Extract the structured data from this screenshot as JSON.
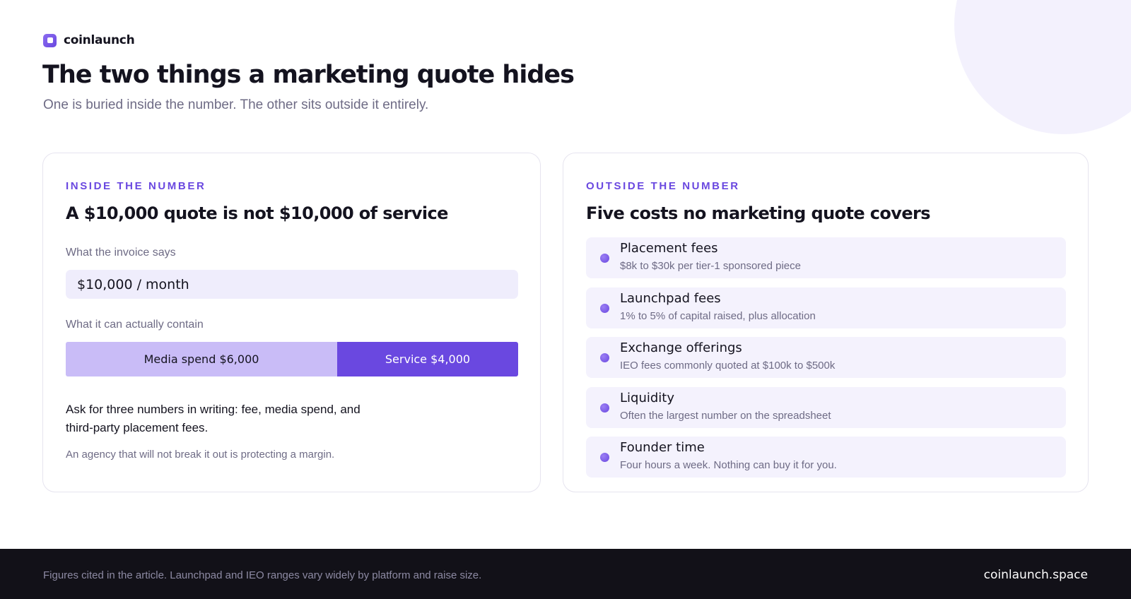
{
  "brand": {
    "name": "coinlaunch",
    "logo_icon": "coinlaunch-logo-icon"
  },
  "header": {
    "title": "The two things a marketing quote hides",
    "subtitle": "One is buried inside the number. The other sits outside it entirely."
  },
  "inside": {
    "eyebrow": "INSIDE THE NUMBER",
    "title": "A $10,000 quote is not $10,000 of service",
    "invoice_label": "What the invoice says",
    "invoice_value": "$10,000 / month",
    "contain_label": "What it can actually contain",
    "breakdown": [
      {
        "label": "Media spend $6,000",
        "amount": 6000
      },
      {
        "label": "Service $4,000",
        "amount": 4000
      }
    ],
    "advice": "Ask for three numbers in writing: fee, media spend, and third-party placement fees.",
    "footnote": "An agency that will not break it out is protecting a margin."
  },
  "outside": {
    "eyebrow": "OUTSIDE THE NUMBER",
    "title": "Five costs no marketing quote covers",
    "items": [
      {
        "name": "Placement fees",
        "desc": "$8k to $30k per tier-1 sponsored piece"
      },
      {
        "name": "Launchpad fees",
        "desc": "1% to 5% of capital raised, plus allocation"
      },
      {
        "name": "Exchange offerings",
        "desc": "IEO fees commonly quoted at $100k to $500k"
      },
      {
        "name": "Liquidity",
        "desc": "Often the largest number on the spreadsheet"
      },
      {
        "name": "Founder time",
        "desc": "Four hours a week. Nothing can buy it for you."
      }
    ]
  },
  "footer": {
    "note": "Figures cited in the article. Launchpad and IEO ranges vary widely by platform and raise size.",
    "domain": "coinlaunch.space"
  },
  "colors": {
    "accent": "#6a48e0",
    "accent_light": "#c9bcf7",
    "text_dark": "#14131f",
    "text_muted": "#6e6b85",
    "footer_bg": "#121118"
  }
}
